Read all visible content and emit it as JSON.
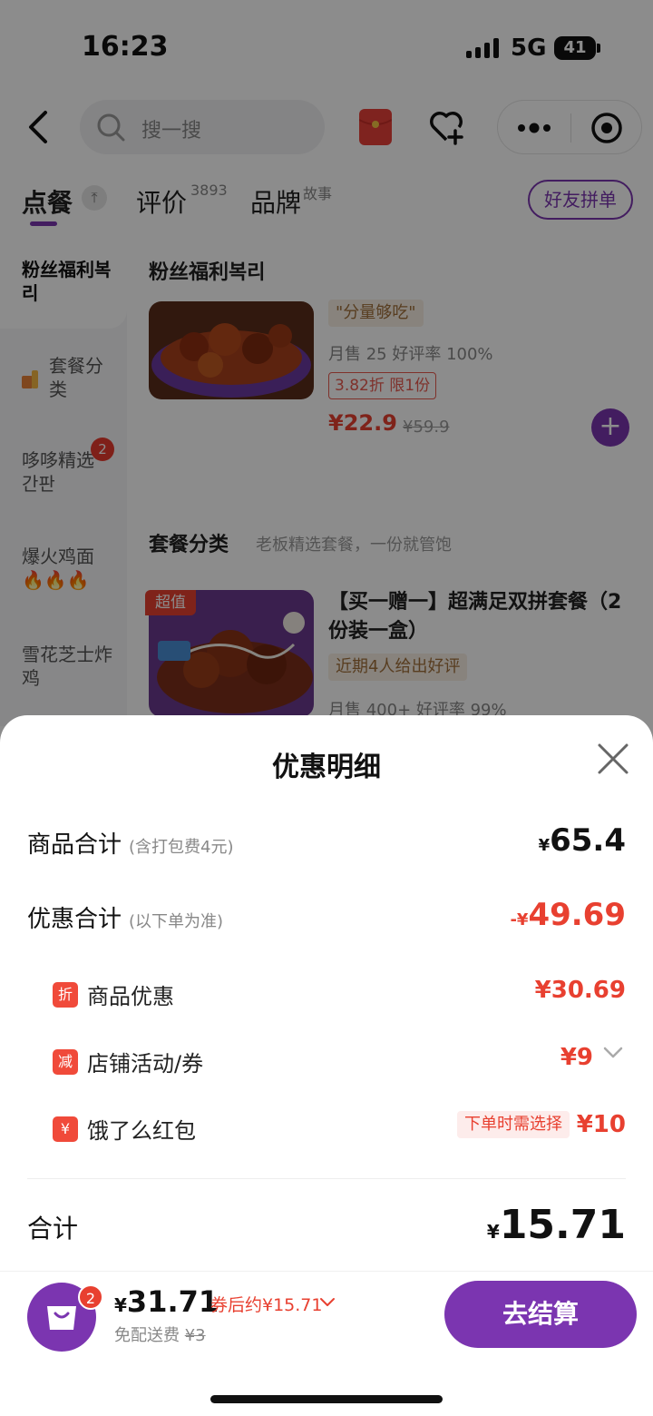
{
  "status_bar": {
    "time": "16:23",
    "network": "5G",
    "battery": "41"
  },
  "header": {
    "search_placeholder": "搜一搜"
  },
  "tabs": {
    "order": "点餐",
    "review": "评价",
    "review_count": "3893",
    "brand": "品牌",
    "brand_sup": "故事",
    "friend_group": "好友拼单"
  },
  "sidebar": {
    "items": [
      {
        "label": "粉丝福利복리"
      },
      {
        "label": "套餐分类"
      },
      {
        "label": "哆哆精选간판",
        "badge": "2"
      },
      {
        "label": "爆火鸡面🔥🔥🔥"
      },
      {
        "label": "雪花芝士炸鸡"
      }
    ]
  },
  "menu": {
    "section1_title": "粉丝福利복리",
    "item1": {
      "tag": "\"分量够吃\"",
      "sales": "月售 25 好评率 100%",
      "discount": "3.82折  限1份",
      "price": "¥22.9",
      "old_price": "¥59.9"
    },
    "section2_title": "套餐分类",
    "section2_sub": "老板精选套餐，一份就管饱",
    "item2": {
      "badge": "超值",
      "name": "【买一赠一】超满足双拼套餐（2份装一盒）",
      "tag": "近期4人给出好评",
      "sales": "月售 400+ 好评率 99%"
    }
  },
  "sheet": {
    "title": "优惠明细",
    "goods_total_label": "商品合计",
    "goods_total_note": "(含打包费4元)",
    "goods_total_value": "65.4",
    "discount_total_label": "优惠合计",
    "discount_total_note": "(以下单为准)",
    "discount_total_value": "49.69",
    "rows": [
      {
        "icon": "折",
        "label": "商品优惠",
        "value": "¥30.69"
      },
      {
        "icon": "减",
        "label": "店铺活动/券",
        "value": "¥9"
      },
      {
        "icon": "¥",
        "label": "饿了么红包",
        "value": "¥10",
        "note": "下单时需选择"
      }
    ],
    "total_label": "合计",
    "total_value": "15.71"
  },
  "bottom_bar": {
    "cart_count": "2",
    "price": "31.71",
    "after_coupon": "券后约¥15.71",
    "fee_label": "免配送费",
    "fee_old": "¥3",
    "checkout": "去结算"
  },
  "colors": {
    "brand_purple": "#7b35b0",
    "price_red": "#e84030"
  }
}
